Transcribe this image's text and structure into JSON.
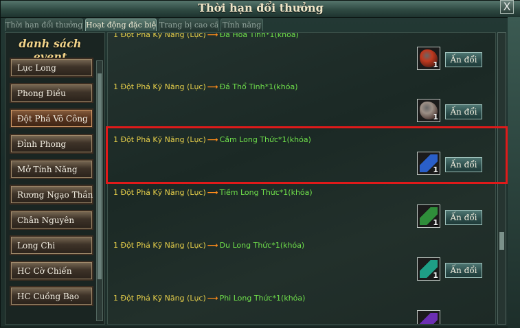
{
  "window": {
    "title": "Thời hạn đổi thưởng",
    "close_label": "X"
  },
  "tabs": [
    {
      "label": "Thời hạn đổi thưởng",
      "active": false
    },
    {
      "label": "Hoạt động đặc biệt",
      "active": true
    },
    {
      "label": "Trang bị cao cấp",
      "active": false
    },
    {
      "label": "Tính năng",
      "active": false
    }
  ],
  "sidebar": {
    "title": "danh sách event",
    "items": [
      {
        "label": "Lục Long"
      },
      {
        "label": "Phong Điều"
      },
      {
        "label": "Đột Phá Võ Công",
        "active": true
      },
      {
        "label": "Đỉnh Phong"
      },
      {
        "label": "Mở Tính Năng"
      },
      {
        "label": "Rương Ngạo Thần"
      },
      {
        "label": "Chân Nguyên"
      },
      {
        "label": "Long Chi"
      },
      {
        "label": "HC Cờ Chiến"
      },
      {
        "label": "HC Cuồng Bạo"
      }
    ]
  },
  "rows": [
    {
      "condition": "1 Đột Phá Kỹ Năng (Lục)",
      "arrow": "⟶",
      "reward": "Đá Hỏa Tinh*1(khóa)",
      "qty": "1",
      "button": "Ấn đổi",
      "icon": "fire-stone-icon",
      "icon_color": "#c0391f"
    },
    {
      "condition": "1 Đột Phá Kỹ Năng (Lục)",
      "arrow": "⟶",
      "reward": "Đá Thổ Tinh*1(khóa)",
      "qty": "1",
      "button": "Ấn đổi",
      "icon": "earth-stone-icon",
      "icon_color": "#9c8f86"
    },
    {
      "condition": "1 Đột Phá Kỹ Năng (Lục)",
      "arrow": "⟶",
      "reward": "Cầm Long Thức*1(khóa)",
      "qty": "1",
      "button": "Ấn đổi",
      "icon": "blue-scroll-icon",
      "icon_color": "#2a5fc9"
    },
    {
      "condition": "1 Đột Phá Kỹ Năng (Lục)",
      "arrow": "⟶",
      "reward": "Tiềm Long Thức*1(khóa)",
      "qty": "1",
      "button": "Ấn đổi",
      "icon": "green-scroll-icon",
      "icon_color": "#2f8d3a"
    },
    {
      "condition": "1 Đột Phá Kỹ Năng (Lục)",
      "arrow": "⟶",
      "reward": "Du Long Thức*1(khóa)",
      "qty": "1",
      "button": "Ấn đổi",
      "icon": "teal-scroll-icon",
      "icon_color": "#1e9e86"
    },
    {
      "condition": "1 Đột Phá Kỹ Năng (Lục)",
      "arrow": "⟶",
      "reward": "Phi Long Thức*1(khóa)",
      "qty": "",
      "button": "",
      "icon": "purple-scroll-icon",
      "icon_color": "#6c2fb3"
    }
  ],
  "colors": {
    "condition": "#e6cf4a",
    "arrow": "#ff8c1a",
    "reward": "#6fe04b",
    "highlight": "#e01a1a"
  }
}
